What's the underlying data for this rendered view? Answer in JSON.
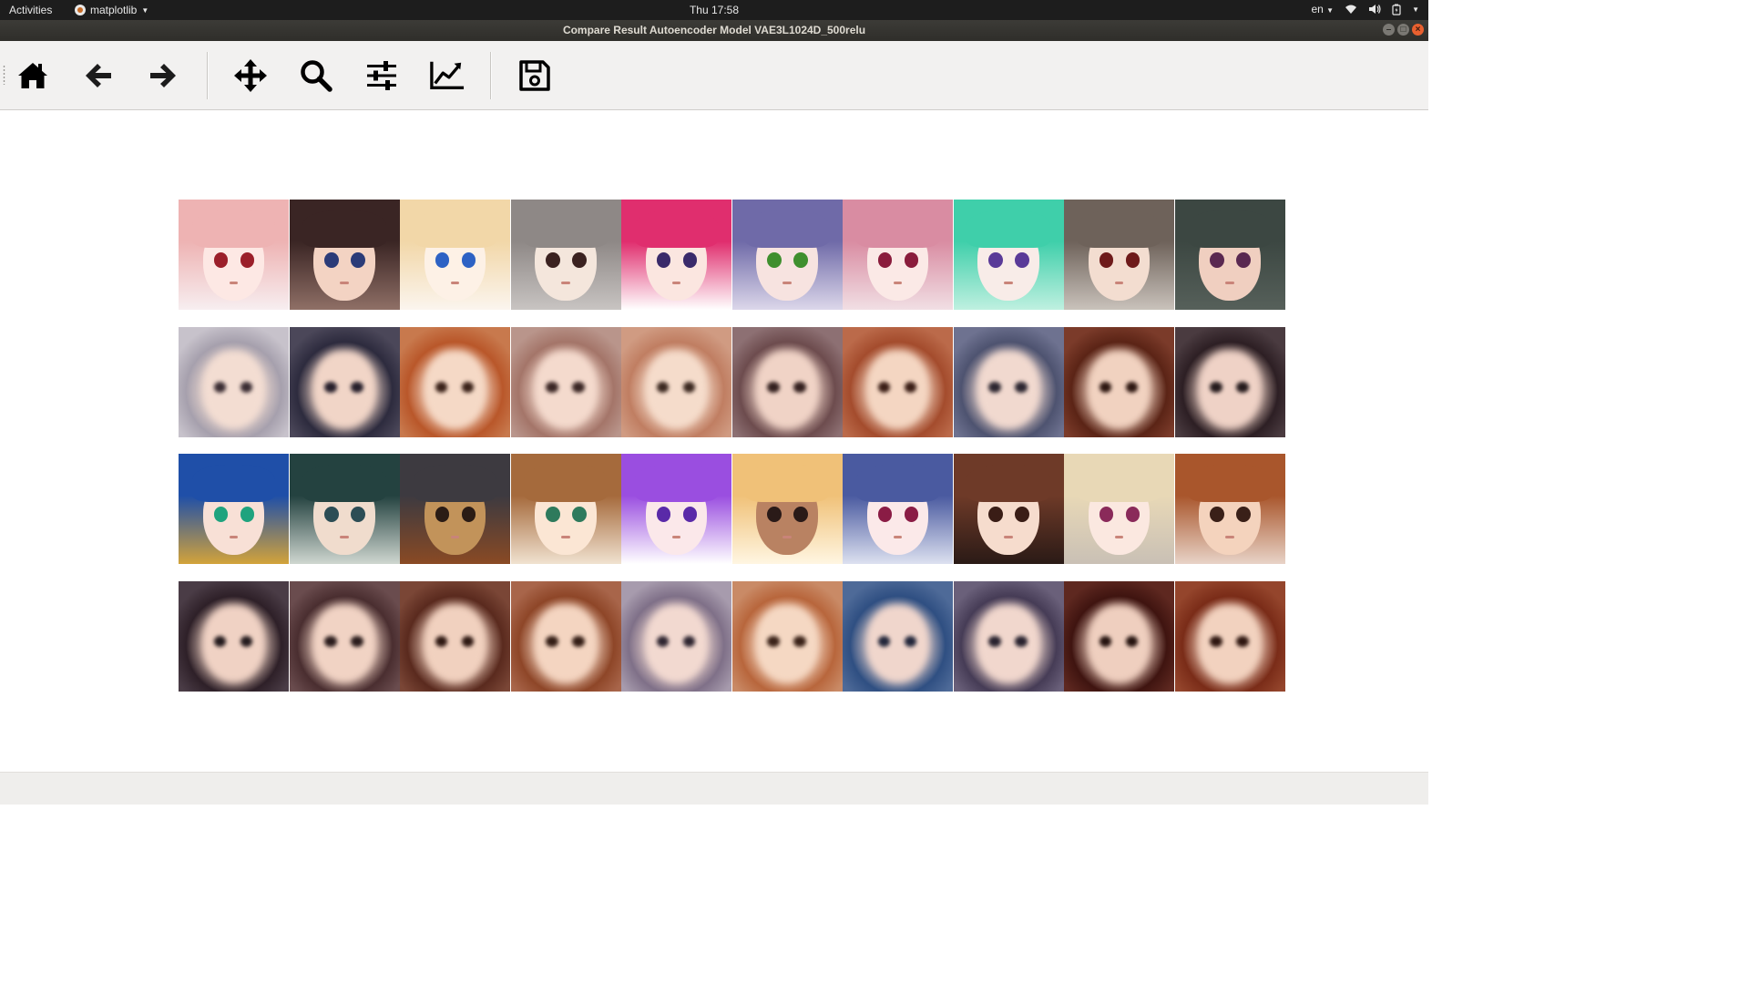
{
  "topbar": {
    "activities": "Activities",
    "app_name": "matplotlib",
    "clock": "Thu 17:58",
    "language": "en"
  },
  "window": {
    "title": "Compare Result Autoencoder Model VAE3L1024D_500relu"
  },
  "toolbar": {
    "buttons": [
      {
        "icon": "home-icon",
        "tooltip": "Home"
      },
      {
        "icon": "back-arrow-icon",
        "tooltip": "Back"
      },
      {
        "icon": "forward-arrow-icon",
        "tooltip": "Forward"
      },
      {
        "icon": "pan-move-icon",
        "tooltip": "Pan"
      },
      {
        "icon": "zoom-icon",
        "tooltip": "Zoom"
      },
      {
        "icon": "subplots-sliders-icon",
        "tooltip": "Subplots"
      },
      {
        "icon": "edit-axes-icon",
        "tooltip": "Customize"
      },
      {
        "icon": "save-floppy-icon",
        "tooltip": "Save"
      }
    ]
  },
  "figure": {
    "rows": [
      {
        "kind": "original",
        "tiles": [
          {
            "hair": "#eeb3b3",
            "skin": "#fde8e4",
            "eyes": "#9b1f2a",
            "bg": "#f7eef0"
          },
          {
            "hair": "#3a2524",
            "skin": "#f3d3c3",
            "eyes": "#2b3b78",
            "bg": "#8f6f66"
          },
          {
            "hair": "#f2d7a8",
            "skin": "#fdf1e6",
            "eyes": "#2d62c4",
            "bg": "#fbf5ee"
          },
          {
            "hair": "#8e8886",
            "skin": "#f4e6dc",
            "eyes": "#3b2220",
            "bg": "#c8c4c2"
          },
          {
            "hair": "#e02e6e",
            "skin": "#fbe6e0",
            "eyes": "#3a2a6a",
            "bg": "#ffffff"
          },
          {
            "hair": "#6f6aa8",
            "skin": "#f7e3e0",
            "eyes": "#3f8f2e",
            "bg": "#dcd7ea"
          },
          {
            "hair": "#d98ca2",
            "skin": "#fbe9e6",
            "eyes": "#8a1c3c",
            "bg": "#f1dfe4"
          },
          {
            "hair": "#3fcfaa",
            "skin": "#f8ece8",
            "eyes": "#5a3a98",
            "bg": "#bff0e0"
          },
          {
            "hair": "#6e625a",
            "skin": "#f3ddd0",
            "eyes": "#6e1a1a",
            "bg": "#c9c2bb"
          },
          {
            "hair": "#3c4742",
            "skin": "#f0cfc0",
            "eyes": "#5a2850",
            "bg": "#56605a"
          }
        ]
      },
      {
        "kind": "reconstruction",
        "tiles": [
          {
            "hair": "#a6a0ad",
            "skin": "#f3ddd2",
            "eyes": "#3a2d33",
            "bg": "#c7c2cb"
          },
          {
            "hair": "#2d2b3e",
            "skin": "#f1d5c7",
            "eyes": "#261f2b",
            "bg": "#4b4759"
          },
          {
            "hair": "#b9572a",
            "skin": "#f5d9c6",
            "eyes": "#3a2219",
            "bg": "#c8794d"
          },
          {
            "hair": "#a47569",
            "skin": "#f4dacd",
            "eyes": "#3a2624",
            "bg": "#b9958b"
          },
          {
            "hair": "#c07e62",
            "skin": "#f5dccb",
            "eyes": "#3b2820",
            "bg": "#d09b82"
          },
          {
            "hair": "#6d4c4e",
            "skin": "#f0d3c6",
            "eyes": "#33201f",
            "bg": "#8d7073"
          },
          {
            "hair": "#a44c2d",
            "skin": "#f4d6c2",
            "eyes": "#3a1e16",
            "bg": "#bb6a4a"
          },
          {
            "hair": "#4e5370",
            "skin": "#f1d9cf",
            "eyes": "#2c2630",
            "bg": "#6e7290"
          },
          {
            "hair": "#5b2416",
            "skin": "#f1d2c0",
            "eyes": "#2d1610",
            "bg": "#7b3b2a"
          },
          {
            "hair": "#2d1f24",
            "skin": "#efd2c6",
            "eyes": "#241a1c",
            "bg": "#4a3b40"
          }
        ]
      },
      {
        "kind": "original",
        "tiles": [
          {
            "hair": "#1f4fa8",
            "skin": "#f8e0d6",
            "eyes": "#1fa37e",
            "bg": "#d3a33a"
          },
          {
            "hair": "#244240",
            "skin": "#f0dccd",
            "eyes": "#2c4d55",
            "bg": "#cfd7d0"
          },
          {
            "hair": "#3d3a40",
            "skin": "#c2935a",
            "eyes": "#2b1c15",
            "bg": "#8a4a24"
          },
          {
            "hair": "#a56a3c",
            "skin": "#fbe6d4",
            "eyes": "#2e7a5c",
            "bg": "#f0e2d0"
          },
          {
            "hair": "#9a4ee0",
            "skin": "#fbe8ea",
            "eyes": "#5a2aa8",
            "bg": "#ffffff"
          },
          {
            "hair": "#f0c178",
            "skin": "#b98262",
            "eyes": "#2a1a18",
            "bg": "#fff6e2"
          },
          {
            "hair": "#4a5aa0",
            "skin": "#fbe9e9",
            "eyes": "#8a1c45",
            "bg": "#dde1f0"
          },
          {
            "hair": "#6e3a28",
            "skin": "#f6dccd",
            "eyes": "#3a1d16",
            "bg": "#2a1a16"
          },
          {
            "hair": "#e8d8b6",
            "skin": "#fbe8e0",
            "eyes": "#8a2a5a",
            "bg": "#c9c0b5"
          },
          {
            "hair": "#a9562c",
            "skin": "#f4d3bd",
            "eyes": "#3a2018",
            "bg": "#e8d3c7"
          }
        ]
      },
      {
        "kind": "reconstruction",
        "tiles": [
          {
            "hair": "#2e2028",
            "skin": "#f0d2c4",
            "eyes": "#231a1d",
            "bg": "#4a3c46"
          },
          {
            "hair": "#4a2e30",
            "skin": "#f1d3c4",
            "eyes": "#2a1c1c",
            "bg": "#6a4c4e"
          },
          {
            "hair": "#5a2a1e",
            "skin": "#f1d1bf",
            "eyes": "#2e1812",
            "bg": "#7a4636"
          },
          {
            "hair": "#8e4628",
            "skin": "#f4d5c1",
            "eyes": "#331d15",
            "bg": "#a8654a"
          },
          {
            "hair": "#7f7088",
            "skin": "#f2d9d0",
            "eyes": "#2e2530",
            "bg": "#a79bad"
          },
          {
            "hair": "#b8663c",
            "skin": "#f5d8c3",
            "eyes": "#3a2218",
            "bg": "#c98a66"
          },
          {
            "hair": "#2f4f82",
            "skin": "#f0d6cc",
            "eyes": "#22263a",
            "bg": "#4e6a98"
          },
          {
            "hair": "#463c56",
            "skin": "#f1d7cd",
            "eyes": "#28222e",
            "bg": "#6a607a"
          },
          {
            "hair": "#3f1410",
            "skin": "#efcfbf",
            "eyes": "#24120e",
            "bg": "#5e2820"
          },
          {
            "hair": "#7a2c18",
            "skin": "#f2d2bf",
            "eyes": "#2e1610",
            "bg": "#94452c"
          }
        ]
      }
    ]
  }
}
